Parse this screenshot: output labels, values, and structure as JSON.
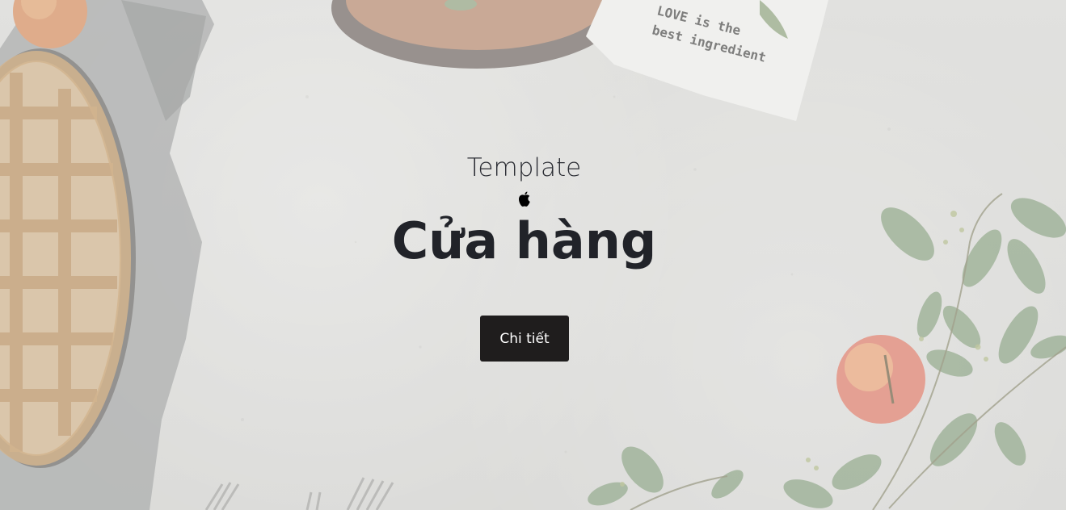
{
  "hero": {
    "eyebrow": "Template",
    "icon": "apple-icon",
    "title": "Cửa hàng",
    "cta_label": "Chi tiết"
  },
  "napkin": {
    "text_line1": "LOVE is the",
    "text_line2": "best ingredient"
  },
  "colors": {
    "button_bg": "#1f1d1d",
    "button_text": "#ffffff",
    "title_text": "#212329",
    "background": "#d9d9d7"
  }
}
